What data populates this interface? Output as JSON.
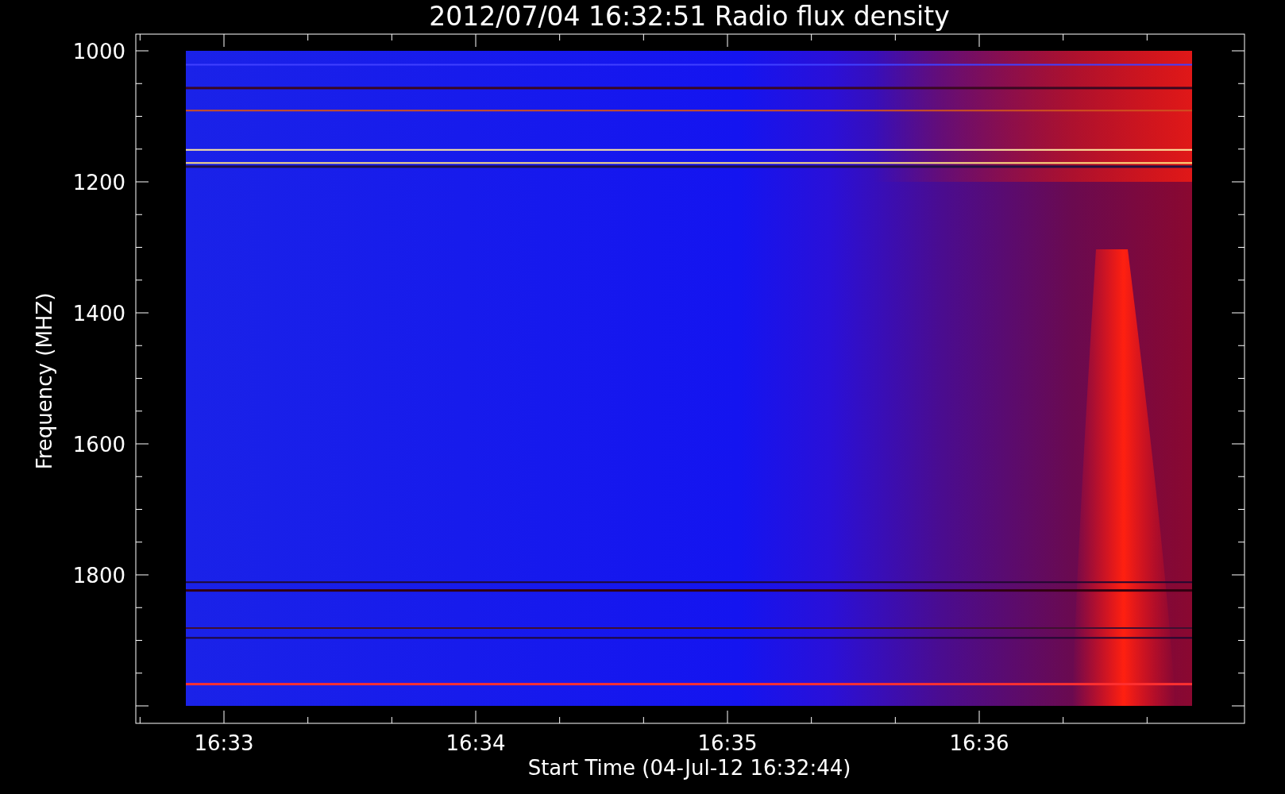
{
  "title": "2012/07/04 16:32:51 Radio flux density",
  "y_axis": {
    "label": "Frequency (MHZ)",
    "ticks": [
      "1000",
      "1200",
      "1400",
      "1600",
      "1800"
    ]
  },
  "x_axis": {
    "label": "Start Time (04-Jul-12 16:32:44)",
    "ticks": [
      "16:33",
      "16:34",
      "16:35",
      "16:36"
    ]
  }
}
